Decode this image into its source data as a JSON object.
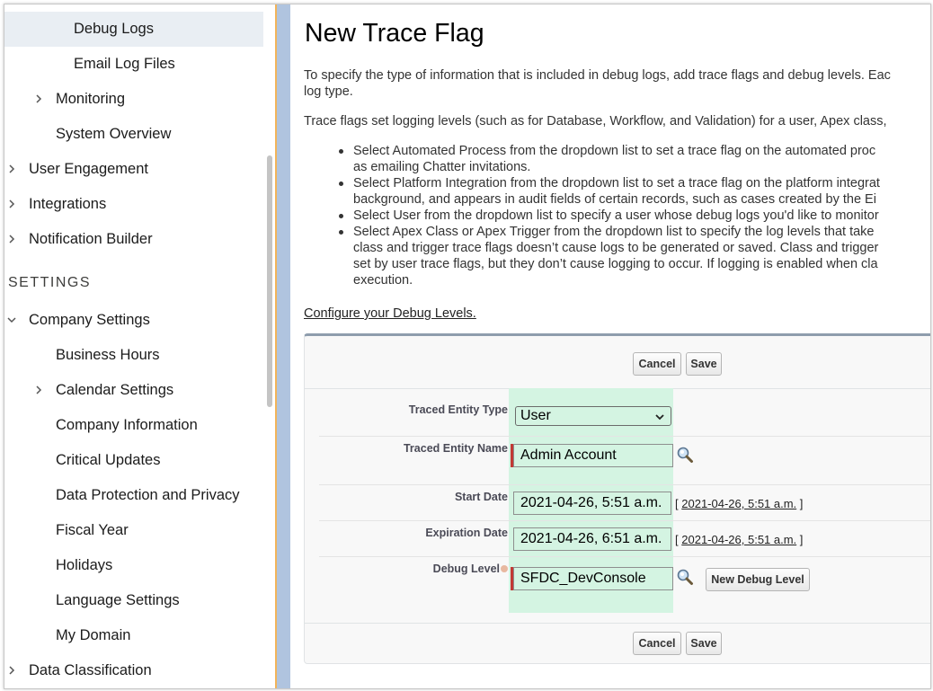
{
  "sidebar": {
    "items": [
      {
        "label": "Debug Logs",
        "indent": 2,
        "chevron": "none",
        "selected": true
      },
      {
        "label": "Email Log Files",
        "indent": 2,
        "chevron": "none",
        "selected": false
      },
      {
        "label": "Monitoring",
        "indent": 1,
        "chevron": "right",
        "selected": false
      },
      {
        "label": "System Overview",
        "indent": 1,
        "chevron": "none",
        "selected": false
      },
      {
        "label": "User Engagement",
        "indent": 0,
        "chevron": "right",
        "selected": false
      },
      {
        "label": "Integrations",
        "indent": 0,
        "chevron": "right",
        "selected": false
      },
      {
        "label": "Notification Builder",
        "indent": 0,
        "chevron": "right",
        "selected": false
      }
    ],
    "settings_heading": "SETTINGS",
    "settings_items": [
      {
        "label": "Company Settings",
        "indent": 0,
        "chevron": "down"
      },
      {
        "label": "Business Hours",
        "indent": 1,
        "chevron": "none"
      },
      {
        "label": "Calendar Settings",
        "indent": 1,
        "chevron": "right"
      },
      {
        "label": "Company Information",
        "indent": 1,
        "chevron": "none"
      },
      {
        "label": "Critical Updates",
        "indent": 1,
        "chevron": "none"
      },
      {
        "label": "Data Protection and Privacy",
        "indent": 1,
        "chevron": "none"
      },
      {
        "label": "Fiscal Year",
        "indent": 1,
        "chevron": "none"
      },
      {
        "label": "Holidays",
        "indent": 1,
        "chevron": "none"
      },
      {
        "label": "Language Settings",
        "indent": 1,
        "chevron": "none"
      },
      {
        "label": "My Domain",
        "indent": 1,
        "chevron": "none"
      },
      {
        "label": "Data Classification",
        "indent": 0,
        "chevron": "right"
      }
    ]
  },
  "main": {
    "title": "New Trace Flag",
    "intro_line1": "To specify the type of information that is included in debug logs, add trace flags and debug levels. Eac",
    "intro_line2": "log type.",
    "trace_para": "Trace flags set logging levels (such as for Database, Workflow, and Validation) for a user, Apex class,",
    "bullets": [
      "Select Automated Process from the dropdown list to set a trace flag on the automated proc",
      "as emailing Chatter invitations.",
      "Select Platform Integration from the dropdown list to set a trace flag on the platform integrat",
      "background, and appears in audit fields of certain records, such as cases created by the Ei",
      "Select User from the dropdown list to specify a user whose debug logs you'd like to monitor",
      "Select Apex Class or Apex Trigger from the dropdown list to specify the log levels that take",
      "class and trigger trace flags doesn’t cause logs to be generated or saved. Class and trigger",
      "set by user trace flags, but they don’t cause logging to occur. If logging is enabled when cla",
      "execution."
    ],
    "bullet_starts": [
      true,
      false,
      true,
      false,
      true,
      true,
      false,
      false,
      false
    ],
    "config_link": "Configure your Debug Levels."
  },
  "form": {
    "cancel_label": "Cancel",
    "save_label": "Save",
    "traced_entity_type_label": "Traced Entity Type",
    "traced_entity_type_value": "User",
    "traced_entity_name_label": "Traced Entity Name",
    "traced_entity_name_value": "Admin Account",
    "start_date_label": "Start Date",
    "start_date_value": "2021-04-26, 5:51 a.m.",
    "start_date_link": "2021-04-26, 5:51 a.m.",
    "expiration_date_label": "Expiration Date",
    "expiration_date_value": "2021-04-26, 6:51 a.m.",
    "expiration_date_link": "2021-04-26, 5:51 a.m.",
    "debug_level_label": "Debug Level",
    "debug_level_value": "SFDC_DevConsole",
    "new_debug_level_label": "New Debug Level",
    "bracket_open": "[",
    "bracket_close": "]"
  },
  "colors": {
    "required": "#c23934",
    "field_bg": "#d4f4e2",
    "selected_nav": "#e9eef3",
    "divider": "#f2b45a",
    "blue_bar": "#b0c4df"
  }
}
